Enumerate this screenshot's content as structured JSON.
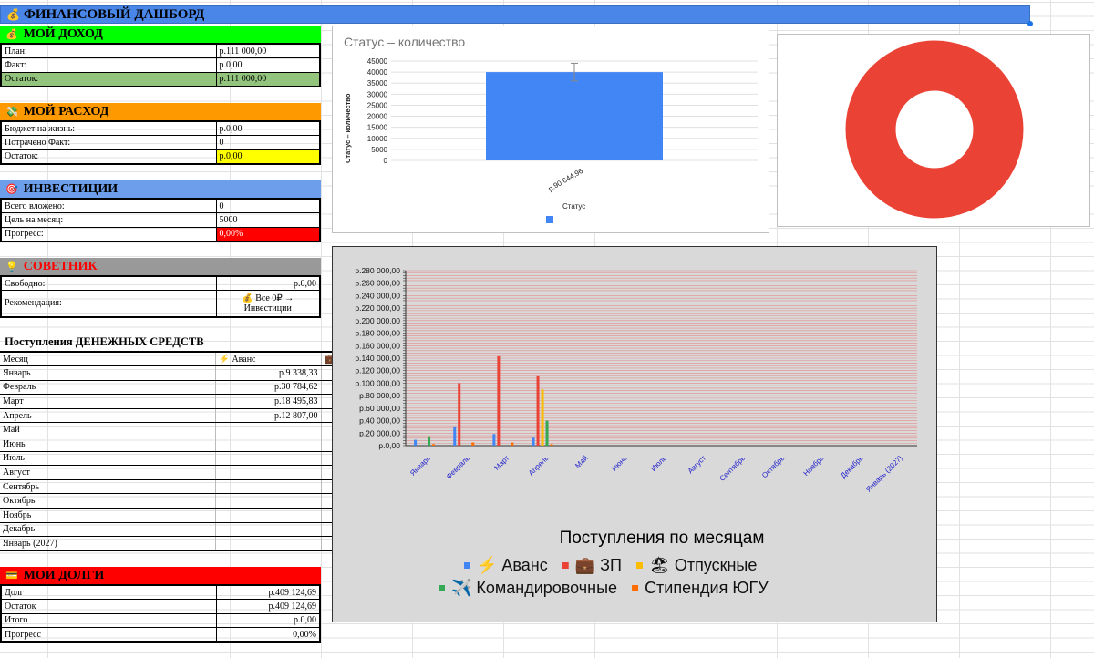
{
  "title": "ФИНАНСОВЫЙ ДАШБОРД",
  "income": {
    "header": "МОЙ ДОХОД",
    "rows": [
      {
        "label": "План:",
        "value": "р.111 000,00"
      },
      {
        "label": "Факт:",
        "value": "р.0,00"
      },
      {
        "label": "Остаток:",
        "value": "р.111 000,00"
      }
    ]
  },
  "expense": {
    "header": "МОЙ РАСХОД",
    "rows": [
      {
        "label": "Бюджет на жизнь:",
        "value": "р.0,00"
      },
      {
        "label": "Потрачено Факт:",
        "value": "0"
      },
      {
        "label": "Остаток:",
        "value": "р.0,00"
      }
    ]
  },
  "invest": {
    "header": "ИНВЕСТИЦИИ",
    "rows": [
      {
        "label": "Всего вложено:",
        "value": "0"
      },
      {
        "label": "Цель на месяц:",
        "value": "5000"
      },
      {
        "label": "Прогресс:",
        "value": "0,00%"
      }
    ]
  },
  "advisor": {
    "header": "СОВЕТНИК",
    "free_label": "Свободно:",
    "free_value": "р.0,00",
    "rec_label": "Рекомендация:",
    "rec_value_line1": "💰 Все 0₽ →",
    "rec_value_line2": "Инвестиции"
  },
  "cashflow": {
    "title": "Поступления ДЕНЕЖНЫХ СРЕДСТВ",
    "col_month": "Месяц",
    "col_advance": "⚡ Аванс",
    "col_next_icon": "💼",
    "rows": [
      {
        "month": "Январь",
        "value": "р.9 338,33"
      },
      {
        "month": "Февраль",
        "value": "р.30 784,62"
      },
      {
        "month": "Март",
        "value": "р.18 495,83"
      },
      {
        "month": "Апрель",
        "value": "р.12 807,00"
      },
      {
        "month": "Май",
        "value": ""
      },
      {
        "month": "Июнь",
        "value": ""
      },
      {
        "month": "Июль",
        "value": ""
      },
      {
        "month": "Август",
        "value": ""
      },
      {
        "month": "Сентябрь",
        "value": ""
      },
      {
        "month": "Октябрь",
        "value": ""
      },
      {
        "month": "Ноябрь",
        "value": ""
      },
      {
        "month": "Декабрь",
        "value": ""
      },
      {
        "month": "Январь (2027)",
        "value": ""
      }
    ]
  },
  "debts": {
    "header": "МОИ ДОЛГИ",
    "rows": [
      {
        "label": "Долг",
        "value": "р.409 124,69"
      },
      {
        "label": "Остаток",
        "value": "р.409 124,69"
      },
      {
        "label": "Итого",
        "value": "р.0,00"
      },
      {
        "label": "Прогресс",
        "value": "0,00%"
      }
    ]
  },
  "colors": {
    "title_bar": "#4a86e8",
    "income_header": "#00ff00",
    "income_remaining": "#93c47d",
    "expense_header": "#ff9900",
    "expense_remaining": "#ffff00",
    "invest_header": "#6d9eeb",
    "progress_red": "#ff0000",
    "advisor_header": "#999999",
    "advisor_text": "#ff0000",
    "debts_header": "#ff0000",
    "avans": "#4285f4",
    "zp": "#ea4335",
    "otpusk": "#fbbc04",
    "komandir": "#34a853",
    "stipend": "#ff6d01"
  },
  "icons": {
    "title": "money-bag-icon",
    "income": "money-bag-icon",
    "expense": "flying-money-icon",
    "invest": "target-icon",
    "advisor": "lightbulb-icon",
    "debts": "credit-card-icon"
  },
  "chart_data": [
    {
      "type": "bar",
      "title": "Статус – количество",
      "xlabel": "Статус",
      "ylabel": "Статус – количество",
      "categories": [
        "р.90 644,96"
      ],
      "series": [
        {
          "name": "",
          "values": [
            40000
          ]
        }
      ],
      "error_bar": [
        36000,
        44000
      ],
      "ylim": [
        0,
        45000
      ],
      "yticks": [
        0,
        5000,
        10000,
        15000,
        20000,
        25000,
        30000,
        35000,
        40000,
        45000
      ],
      "legend": "bottom"
    },
    {
      "type": "pie",
      "donut": true,
      "values": [
        1
      ],
      "colors": [
        "#ea4335"
      ]
    },
    {
      "type": "bar",
      "title": "Поступления по месяцам",
      "categories": [
        "Январь",
        "Февраль",
        "Март",
        "Апрель",
        "Май",
        "Июнь",
        "Июль",
        "Август",
        "Сентябрь",
        "Октябрь",
        "Ноябрь",
        "Декабрь",
        "Январь (2027)"
      ],
      "series": [
        {
          "name": "⚡ Аванс",
          "color": "#4285f4",
          "values": [
            9338.33,
            30784.62,
            18495.83,
            12807,
            0,
            0,
            0,
            0,
            0,
            0,
            0,
            0,
            0
          ]
        },
        {
          "name": "💼 ЗП",
          "color": "#ea4335",
          "values": [
            0,
            100000,
            143000,
            111000,
            0,
            0,
            0,
            0,
            0,
            0,
            0,
            0,
            0
          ]
        },
        {
          "name": "🏖 Отпускные",
          "color": "#fbbc04",
          "values": [
            0,
            0,
            0,
            90000,
            0,
            0,
            0,
            0,
            0,
            0,
            0,
            0,
            0
          ]
        },
        {
          "name": "✈️ Командировочные",
          "color": "#34a853",
          "values": [
            15000,
            0,
            0,
            40000,
            0,
            0,
            0,
            0,
            0,
            0,
            0,
            0,
            0
          ]
        },
        {
          "name": "Стипендия ЮГУ",
          "color": "#ff6d01",
          "values": [
            2500,
            5000,
            5000,
            2500,
            0,
            0,
            0,
            0,
            0,
            0,
            0,
            0,
            0
          ]
        }
      ],
      "ylim": [
        0,
        280000
      ],
      "ytick_labels": [
        "р.0,00",
        "р.20 000,00",
        "р.40 000,00",
        "р.60 000,00",
        "р.80 000,00",
        "р.100 000,00",
        "р.120 000,00",
        "р.140 000,00",
        "р.160 000,00",
        "р.180 000,00",
        "р.200 000,00",
        "р.220 000,00",
        "р.240 000,00",
        "р.260 000,00",
        "р.280 000,00"
      ],
      "legend": "bottom"
    }
  ]
}
